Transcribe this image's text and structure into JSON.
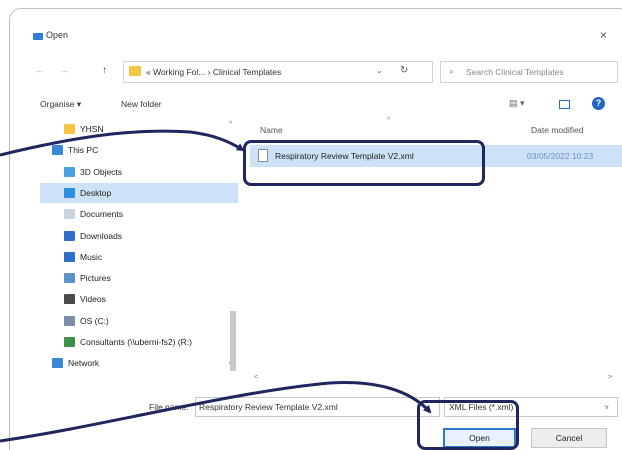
{
  "window": {
    "title": "Open",
    "close_glyph": "×"
  },
  "nav": {
    "back_glyph": "←",
    "forward_glyph": "→",
    "up_glyph": "↑",
    "address_path": "« Working Fol... › Clinical Templates",
    "address_dropdown_glyph": "⌄",
    "refresh_glyph": "↻",
    "search_placeholder": "Search Clinical Templates",
    "search_glyph": "⌕"
  },
  "commandbar": {
    "organise_label": "Organise ▾",
    "new_folder_label": "New folder",
    "view_glyph": "▤ ▾",
    "help_glyph": "?"
  },
  "sidebar": {
    "items": [
      {
        "label": "YHSN",
        "icon": "folder-icon",
        "color": "#f5c542",
        "indent": 1
      },
      {
        "label": "This PC",
        "icon": "computer-icon",
        "color": "#3a86d8",
        "indent": 0
      },
      {
        "label": "3D Objects",
        "icon": "cube-icon",
        "color": "#4aa3e0",
        "indent": 1
      },
      {
        "label": "Desktop",
        "icon": "desktop-icon",
        "color": "#2e8fe0",
        "indent": 1,
        "selected": true
      },
      {
        "label": "Documents",
        "icon": "documents-icon",
        "color": "#c9d3dd",
        "indent": 1
      },
      {
        "label": "Downloads",
        "icon": "downloads-icon",
        "color": "#2f6fce",
        "indent": 1
      },
      {
        "label": "Music",
        "icon": "music-icon",
        "color": "#2f6fce",
        "indent": 1
      },
      {
        "label": "Pictures",
        "icon": "pictures-icon",
        "color": "#5b93c9",
        "indent": 1
      },
      {
        "label": "Videos",
        "icon": "videos-icon",
        "color": "#4a4a4a",
        "indent": 1
      },
      {
        "label": "OS (C:)",
        "icon": "drive-icon",
        "color": "#7a8fa6",
        "indent": 1
      },
      {
        "label": "Consultants (\\\\uberni-fs2) (R:)",
        "icon": "network-drive-icon",
        "color": "#3d8f4a",
        "indent": 1
      },
      {
        "label": "Network",
        "icon": "network-icon",
        "color": "#3a86d8",
        "indent": 0
      }
    ],
    "scroll_up_glyph": "^",
    "scroll_down_glyph": "v"
  },
  "files": {
    "col_name": "Name",
    "col_date": "Date modified",
    "sort_glyph": "^",
    "rows": [
      {
        "name": "Respiratory Review Template V2.xml",
        "date": "03/05/2022 10:23",
        "selected": true
      }
    ],
    "hscroll_left_glyph": "<",
    "hscroll_right_glyph": ">"
  },
  "bottom": {
    "filename_label": "File name:",
    "filename_value": "Respiratory Review Template V2.xml",
    "filename_dropdown_glyph": "v",
    "filetype_value": "XML Files (*.xml)",
    "filetype_dropdown_glyph": "v",
    "open_label": "Open",
    "cancel_label": "Cancel"
  },
  "colors": {
    "selection": "#cde2f6",
    "annotation": "#1f2660",
    "accent": "#2a79cf"
  }
}
